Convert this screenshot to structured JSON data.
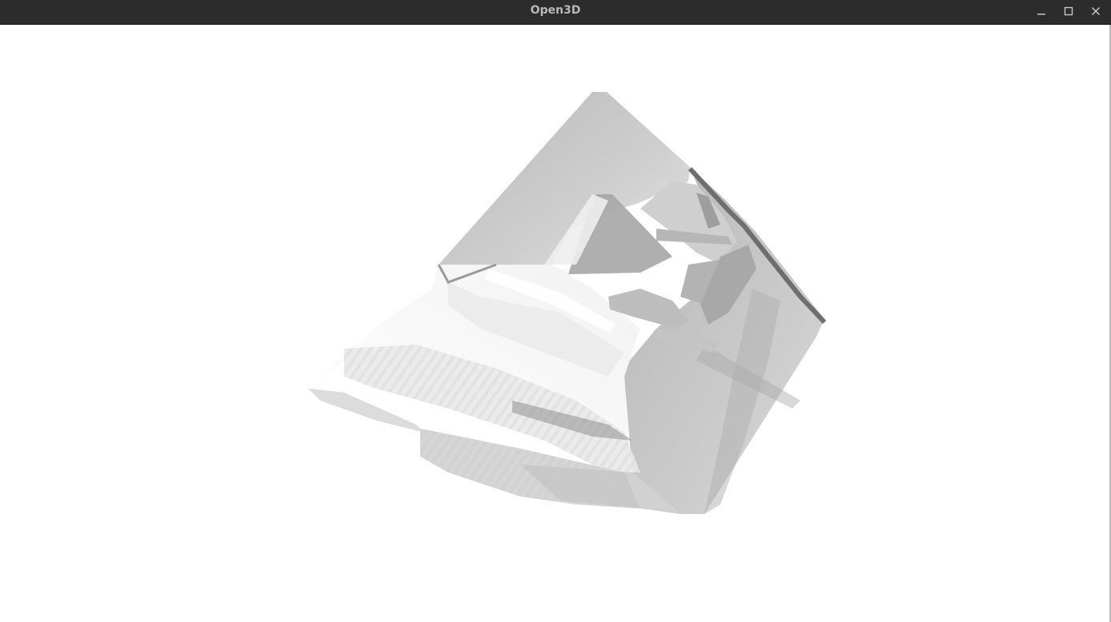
{
  "window": {
    "title": "Open3D",
    "controls": {
      "minimize_icon": "minimize-icon",
      "maximize_icon": "maximize-icon",
      "close_icon": "close-icon"
    },
    "colors": {
      "titlebar": "#2c2c2c",
      "title_text": "#b8b8b8",
      "viewport_background": "#ffffff"
    }
  },
  "viewport": {
    "content": "point-cloud-render"
  }
}
